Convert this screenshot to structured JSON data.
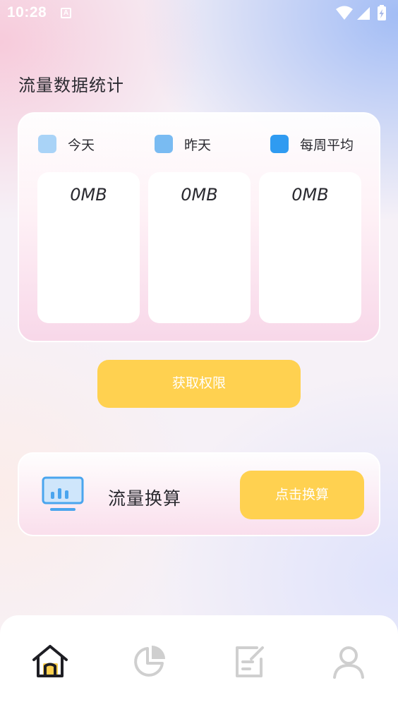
{
  "status_bar": {
    "time": "10:28",
    "notification_badge": "A",
    "icons": [
      "wifi-icon",
      "signal-icon",
      "battery-charging-icon"
    ]
  },
  "page_title": "流量数据统计",
  "legend": [
    {
      "label": "今天",
      "color": "#a9d3f7"
    },
    {
      "label": "昨天",
      "color": "#79bbf2"
    },
    {
      "label": "每周平均",
      "color": "#2f9bf1"
    }
  ],
  "stats": [
    {
      "value": "0MB"
    },
    {
      "value": "0MB"
    },
    {
      "value": "0MB"
    }
  ],
  "permission_button_label": "获取权限",
  "convert": {
    "icon": "monitor-chart-icon",
    "title": "流量换算",
    "button_label": "点击换算"
  },
  "tab_bar": {
    "active_index": 0,
    "items": [
      {
        "icon": "home-icon"
      },
      {
        "icon": "pie-chart-icon"
      },
      {
        "icon": "edit-note-icon"
      },
      {
        "icon": "user-icon"
      }
    ]
  },
  "colors": {
    "accent_yellow": "#ffd150",
    "text_dark": "#2a2a30",
    "icon_gray": "#cfcfcf",
    "icon_blue": "#4aa5ee"
  }
}
